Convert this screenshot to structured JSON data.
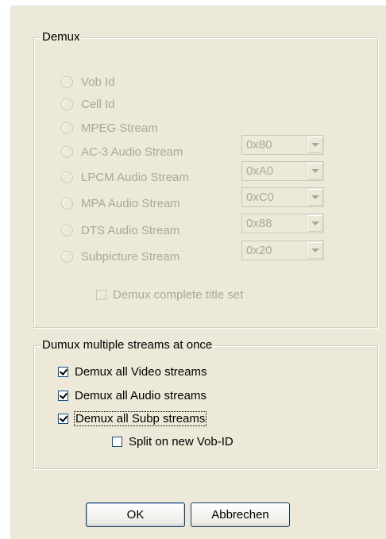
{
  "demux_group": {
    "title": "Demux",
    "radios": [
      {
        "label": "Vob Id"
      },
      {
        "label": "Cell Id"
      },
      {
        "label": "MPEG Stream"
      },
      {
        "label": "AC-3 Audio Stream",
        "combo": "0x80"
      },
      {
        "label": "LPCM Audio Stream",
        "combo": "0xA0"
      },
      {
        "label": "MPA Audio Stream",
        "combo": "0xC0"
      },
      {
        "label": "DTS Audio Stream",
        "combo": "0x88"
      },
      {
        "label": "Subpicture Stream",
        "combo": "0x20"
      }
    ],
    "complete_title_set": {
      "label": "Demux complete title set",
      "checked": false
    }
  },
  "multi_group": {
    "title": "Dumux multiple streams at once",
    "video": {
      "label": "Demux all Video streams",
      "checked": true
    },
    "audio": {
      "label": "Demux all Audio streams",
      "checked": true
    },
    "subp": {
      "label": "Demux all Subp streams",
      "checked": true
    },
    "split": {
      "label": "Split on new Vob-ID",
      "checked": false
    }
  },
  "buttons": {
    "ok": "OK",
    "cancel": "Abbrechen"
  }
}
